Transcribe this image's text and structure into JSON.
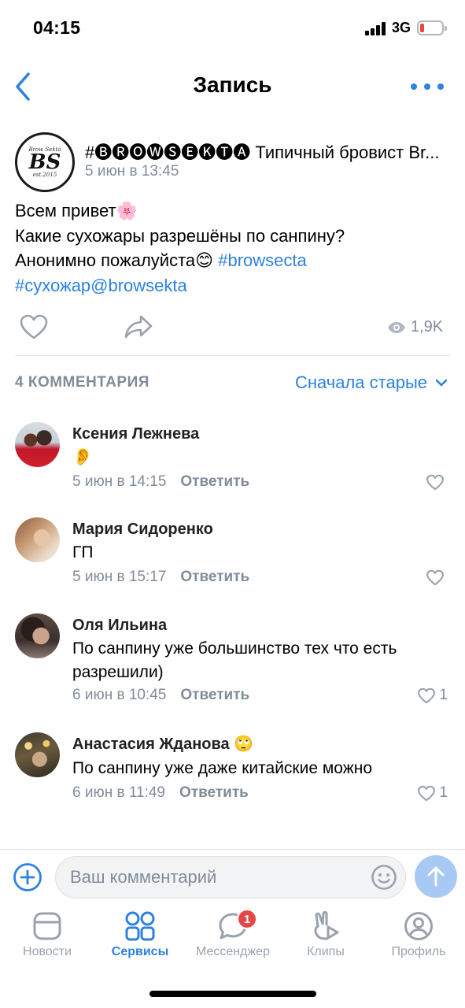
{
  "status_bar": {
    "time": "04:15",
    "network": "3G"
  },
  "header": {
    "title": "Запись"
  },
  "post": {
    "author": "#🅑🅡🅞🅦🅢🅔🅚🅣🅐 Типичный бровист Br...",
    "avatar_text": "BS",
    "avatar_small_top": "Brow Sekta",
    "avatar_small_bottom": "est.2015",
    "date": "5 июн в 13:45",
    "line1": "Всем привет🌸",
    "line2": "Какие сухожары разрешёны по санпину?",
    "line3": "Анонимно пожалуйста😊",
    "hashtag1": "#browsecta",
    "hashtag2": "#сухожар@browsekta",
    "views": "1,9K"
  },
  "comments_header": {
    "count": "4 КОММЕНТАРИЯ",
    "sort": "Сначала старые"
  },
  "comments": [
    {
      "name": "Ксения Лежнева",
      "text": "👂",
      "date": "5 июн в 14:15",
      "reply": "Ответить",
      "likes": ""
    },
    {
      "name": "Мария Сидоренко",
      "text": "ГП",
      "date": "5 июн в 15:17",
      "reply": "Ответить",
      "likes": ""
    },
    {
      "name": "Оля Ильина",
      "text": "По санпину уже большинство тех что есть разрешили)",
      "date": "6 июн в 10:45",
      "reply": "Ответить",
      "likes": "1"
    },
    {
      "name": "Анастасия Жданова 🙄",
      "text": "По санпину уже даже китайские можно",
      "date": "6 июн в 11:49",
      "reply": "Ответить",
      "likes": "1"
    }
  ],
  "composer": {
    "placeholder": "Ваш комментарий"
  },
  "tabbar": {
    "items": [
      {
        "label": "Новости"
      },
      {
        "label": "Сервисы"
      },
      {
        "label": "Мессенджер",
        "badge": "1"
      },
      {
        "label": "Клипы"
      },
      {
        "label": "Профиль"
      }
    ]
  },
  "colors": {
    "accent": "#2d81e0",
    "secondary_text": "#818c99",
    "badge": "#e64646",
    "divider": "#e1e3e6"
  }
}
